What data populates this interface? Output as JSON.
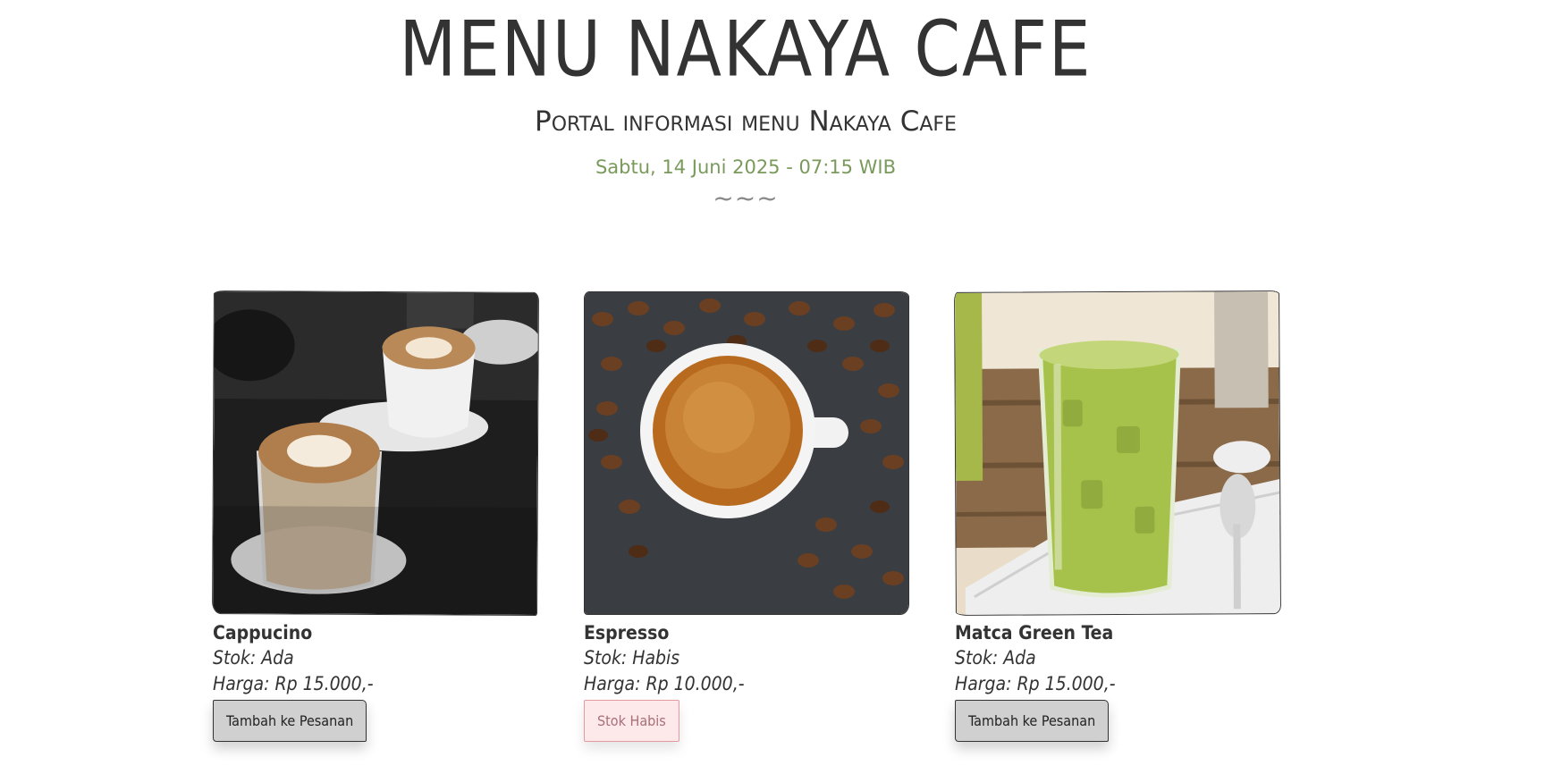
{
  "header": {
    "title": "MENU NAKAYA CAFE",
    "subtitle": "Portal informasi menu Nakaya Cafe",
    "datetime": "Sabtu, 14 Juni 2025 - 07:15 WIB",
    "divider": "~~~"
  },
  "colors": {
    "text": "#333333",
    "accent_green": "#7a9a5c",
    "button_gray": "#d0d0d0",
    "soldout_pink": "#fde8ea",
    "soldout_border": "#e59aa2"
  },
  "menu": {
    "items": [
      {
        "name": "Cappucino",
        "stock": "Stok: Ada",
        "price": "Harga: Rp 15.000,-",
        "button": "Tambah ke Pesanan",
        "image": "cappuccino-photo"
      },
      {
        "name": "Espresso",
        "stock": "Stok: Habis",
        "price": "Harga: Rp 10.000,-",
        "button": "Stok Habis",
        "image": "espresso-photo"
      },
      {
        "name": "Matca Green Tea",
        "stock": "Stok: Ada",
        "price": "Harga: Rp 15.000,-",
        "button": "Tambah ke Pesanan",
        "image": "matcha-photo"
      }
    ]
  }
}
